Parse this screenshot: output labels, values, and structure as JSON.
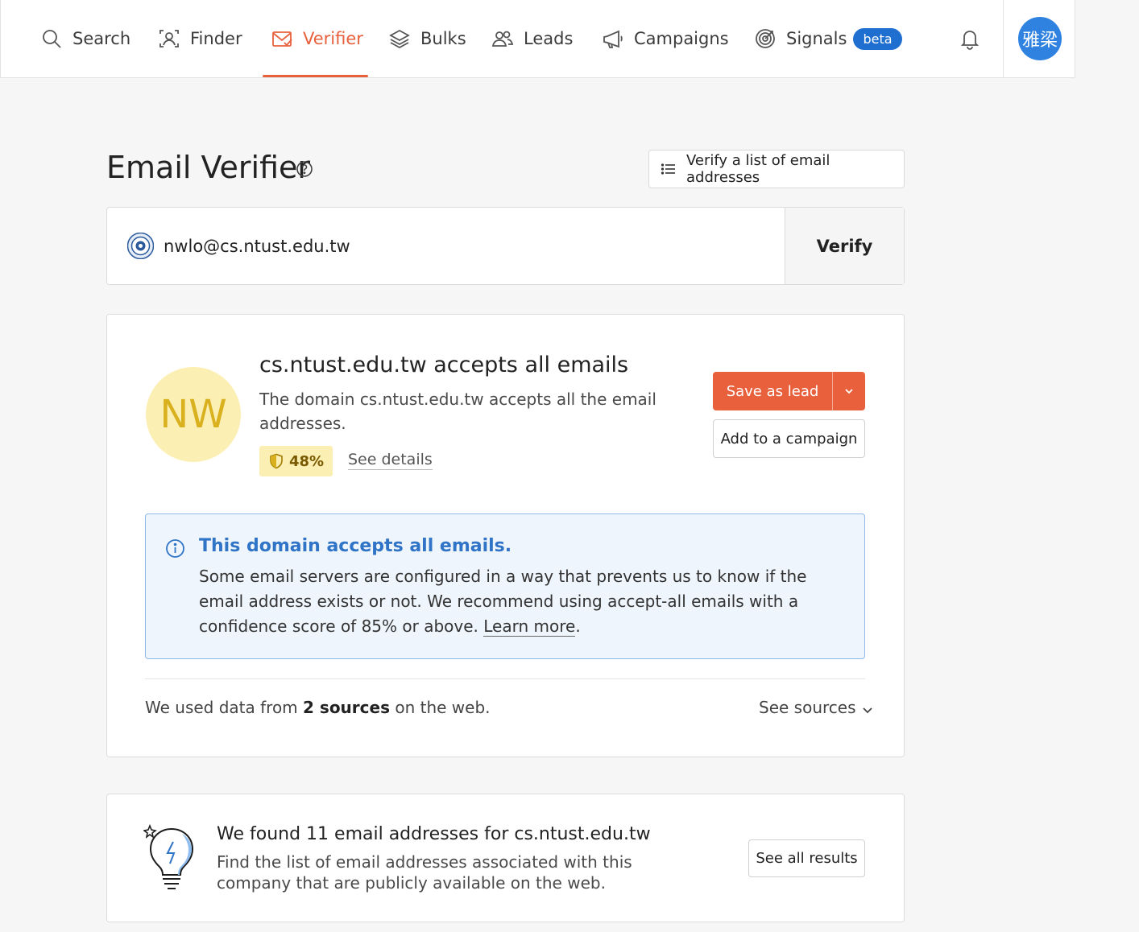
{
  "nav": {
    "items": [
      {
        "label": "Search",
        "icon": "search-icon"
      },
      {
        "label": "Finder",
        "icon": "finder-icon"
      },
      {
        "label": "Verifier",
        "icon": "verifier-icon",
        "active": true
      },
      {
        "label": "Bulks",
        "icon": "layers-icon"
      },
      {
        "label": "Leads",
        "icon": "users-icon"
      },
      {
        "label": "Campaigns",
        "icon": "megaphone-icon"
      },
      {
        "label": "Signals",
        "icon": "target-icon"
      }
    ],
    "signals_badge": "beta",
    "avatar_text": "雅梁",
    "accent_color": "#e8603c",
    "badge_color": "#1f6fd1"
  },
  "header": {
    "title": "Email Verifier",
    "verify_list_label": "Verify a list of email addresses"
  },
  "input": {
    "email": "nwlo@cs.ntust.edu.tw",
    "verify_label": "Verify"
  },
  "result": {
    "initials": "NW",
    "title": "cs.ntust.edu.tw accepts all emails",
    "description": "The domain cs.ntust.edu.tw accepts all the email addresses.",
    "score": "48%",
    "see_details": "See details",
    "save_lead_label": "Save as lead",
    "add_campaign_label": "Add to a campaign",
    "info_title": "This domain accepts all emails.",
    "info_body": "Some email servers are configured in a way that prevents us to know if the email address exists or not. We recommend using accept-all emails with a confidence score of 85% or above.",
    "info_link": "Learn more",
    "info_tail": ".",
    "sources_prefix": "We used data from",
    "sources_count": "2 sources",
    "sources_suffix": "on the web.",
    "see_sources": "See sources"
  },
  "found": {
    "title": "We found 11 email addresses for cs.ntust.edu.tw",
    "description": "Find the list of email addresses associated with this company that are publicly available on the web.",
    "see_all_label": "See all results"
  }
}
